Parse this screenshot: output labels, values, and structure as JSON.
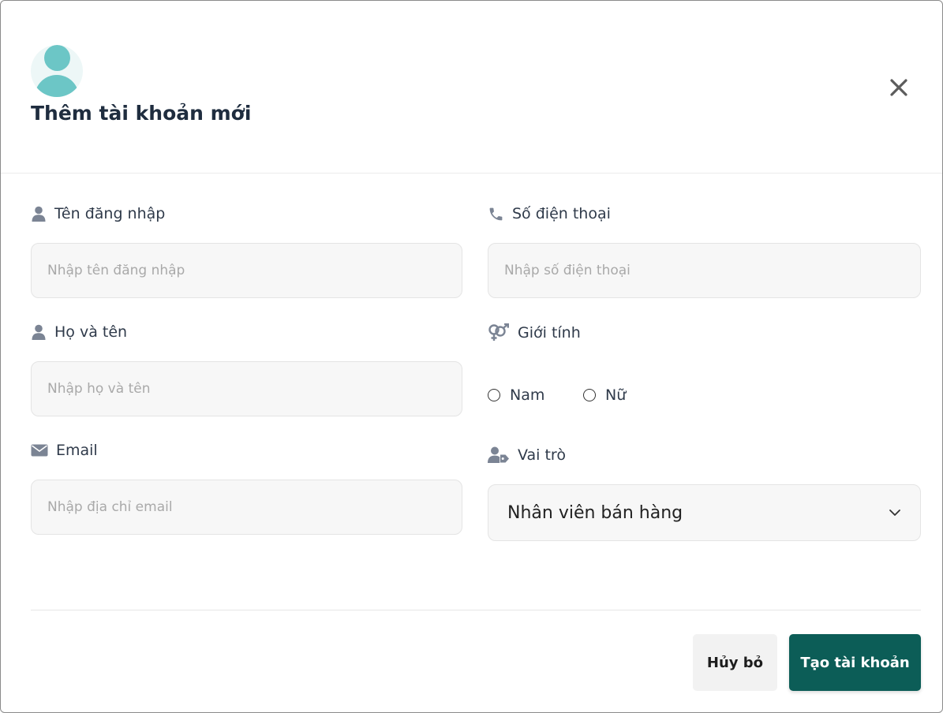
{
  "modal": {
    "title": "Thêm tài khoản mới"
  },
  "form": {
    "username": {
      "label": "Tên đăng nhập",
      "placeholder": "Nhập tên đăng nhập",
      "value": ""
    },
    "fullname": {
      "label": "Họ và tên",
      "placeholder": "Nhập họ và tên",
      "value": ""
    },
    "email": {
      "label": "Email",
      "placeholder": "Nhập địa chỉ email",
      "value": ""
    },
    "phone": {
      "label": "Số điện thoại",
      "placeholder": "Nhập số điện thoại",
      "value": ""
    },
    "gender": {
      "label": "Giới tính",
      "options": [
        {
          "label": "Nam",
          "checked": false
        },
        {
          "label": "Nữ",
          "checked": false
        }
      ]
    },
    "role": {
      "label": "Vai trò",
      "selected": "Nhân viên bán hàng"
    }
  },
  "actions": {
    "cancel_label": "Hủy bỏ",
    "create_label": "Tạo tài khoản"
  },
  "icons": {
    "avatar": "user-avatar-icon",
    "close": "close-icon",
    "username": "user-icon",
    "fullname": "user-icon",
    "email": "envelope-icon",
    "phone": "phone-icon",
    "gender": "gender-icon",
    "role": "user-tag-icon",
    "dropdown": "chevron-down-icon"
  },
  "colors": {
    "primary": "#0c5d57",
    "avatar_accent": "#6cc6c6",
    "icon_gray": "#7b8494",
    "input_bg": "#f7f7f7"
  }
}
